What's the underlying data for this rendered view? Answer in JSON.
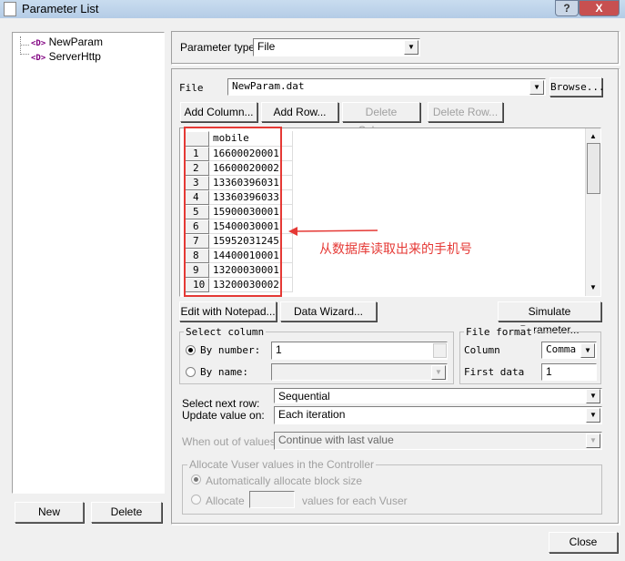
{
  "window": {
    "title": "Parameter List",
    "help_glyph": "?",
    "close_glyph": "X"
  },
  "tree": {
    "items": [
      {
        "icon": "<D>",
        "label": "NewParam"
      },
      {
        "icon": "<D>",
        "label": "ServerHttp"
      }
    ]
  },
  "left_buttons": {
    "new": "New",
    "delete": "Delete"
  },
  "param_type": {
    "label": "Parameter type:",
    "value": "File"
  },
  "file": {
    "label": "File",
    "value": "NewParam.dat",
    "browse": "Browse..."
  },
  "toolbar": {
    "add_column": "Add Column...",
    "add_row": "Add Row...",
    "delete_column": "Delete Column...",
    "delete_row": "Delete Row..."
  },
  "grid": {
    "column": "mobile",
    "rows": [
      {
        "n": "1",
        "v": "16600020001"
      },
      {
        "n": "2",
        "v": "16600020002"
      },
      {
        "n": "3",
        "v": "13360396031"
      },
      {
        "n": "4",
        "v": "13360396033"
      },
      {
        "n": "5",
        "v": "15900030001"
      },
      {
        "n": "6",
        "v": "15400030001"
      },
      {
        "n": "7",
        "v": "15952031245"
      },
      {
        "n": "8",
        "v": "14400010001"
      },
      {
        "n": "9",
        "v": "13200030001"
      },
      {
        "n": "10",
        "v": "13200030002"
      }
    ]
  },
  "annotation": {
    "text": "从数据库读取出来的手机号",
    "color": "#e53935"
  },
  "actions": {
    "edit_notepad": "Edit with Notepad...",
    "data_wizard": "Data Wizard...",
    "simulate": "Simulate Parameter..."
  },
  "select_column": {
    "legend": "Select column",
    "by_number": "By number:",
    "by_number_value": "1",
    "by_name": "By name:"
  },
  "file_format": {
    "legend": "File format",
    "column_label": "Column",
    "column_value": "Comma",
    "first_data_label": "First data",
    "first_data_value": "1"
  },
  "next_row": {
    "label": "Select next row:",
    "value": "Sequential"
  },
  "update": {
    "label": "Update value on:",
    "value": "Each iteration"
  },
  "out_of_values": {
    "label": "When out of values:",
    "value": "Continue with last value"
  },
  "allocate": {
    "legend": "Allocate Vuser values in the Controller",
    "auto": "Automatically allocate block size",
    "manual": "Allocate",
    "manual_suffix": "values for each Vuser"
  },
  "close_button": "Close"
}
